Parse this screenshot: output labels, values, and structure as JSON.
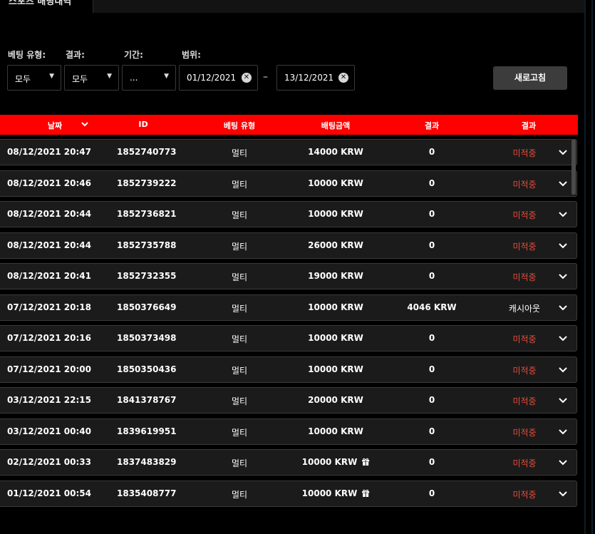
{
  "header": {
    "tab_label": "스포츠 배팅내역"
  },
  "filters": {
    "bet_type_label": "베팅 유형:",
    "result_label": "결과:",
    "period_label": "기간:",
    "range_label": "범위:",
    "bet_type_value": "모두",
    "result_value": "모두",
    "period_value": "...",
    "date_from": "01/12/2021",
    "date_to": "13/12/2021",
    "range_separator": "–",
    "refresh_label": "새로고침"
  },
  "table": {
    "columns": [
      "날짜",
      "ID",
      "베팅 유형",
      "배팅금액",
      "결과",
      "결과"
    ],
    "rows": [
      {
        "date": "08/12/2021 20:47",
        "id": "1852740773",
        "type": "멀티",
        "amount": "14000 KRW",
        "result": "0",
        "status": "미적중",
        "gift": false
      },
      {
        "date": "08/12/2021 20:46",
        "id": "1852739222",
        "type": "멀티",
        "amount": "10000 KRW",
        "result": "0",
        "status": "미적중",
        "gift": false
      },
      {
        "date": "08/12/2021 20:44",
        "id": "1852736821",
        "type": "멀티",
        "amount": "10000 KRW",
        "result": "0",
        "status": "미적중",
        "gift": false
      },
      {
        "date": "08/12/2021 20:44",
        "id": "1852735788",
        "type": "멀티",
        "amount": "26000 KRW",
        "result": "0",
        "status": "미적중",
        "gift": false
      },
      {
        "date": "08/12/2021 20:41",
        "id": "1852732355",
        "type": "멀티",
        "amount": "19000 KRW",
        "result": "0",
        "status": "미적중",
        "gift": false
      },
      {
        "date": "07/12/2021 20:18",
        "id": "1850376649",
        "type": "멀티",
        "amount": "10000 KRW",
        "result": "4046 KRW",
        "status": "캐시아웃",
        "gift": false
      },
      {
        "date": "07/12/2021 20:16",
        "id": "1850373498",
        "type": "멀티",
        "amount": "10000 KRW",
        "result": "0",
        "status": "미적중",
        "gift": false
      },
      {
        "date": "07/12/2021 20:00",
        "id": "1850350436",
        "type": "멀티",
        "amount": "10000 KRW",
        "result": "0",
        "status": "미적중",
        "gift": false
      },
      {
        "date": "03/12/2021 22:15",
        "id": "1841378767",
        "type": "멀티",
        "amount": "20000 KRW",
        "result": "0",
        "status": "미적중",
        "gift": false
      },
      {
        "date": "03/12/2021 00:40",
        "id": "1839619951",
        "type": "멀티",
        "amount": "10000 KRW",
        "result": "0",
        "status": "미적중",
        "gift": false
      },
      {
        "date": "02/12/2021 00:33",
        "id": "1837483829",
        "type": "멀티",
        "amount": "10000 KRW",
        "result": "0",
        "status": "미적중",
        "gift": true
      },
      {
        "date": "01/12/2021 00:54",
        "id": "1835408777",
        "type": "멀티",
        "amount": "10000 KRW",
        "result": "0",
        "status": "미적중",
        "gift": true
      }
    ]
  },
  "colors": {
    "accent": "#ff0000",
    "pending": "#e74c3c",
    "row_bg": "#1b1b1b"
  },
  "icons": {
    "sort": "chevron-down-icon",
    "expand": "chevron-down-icon",
    "clear": "close-circle-icon",
    "gift": "gift-icon"
  }
}
